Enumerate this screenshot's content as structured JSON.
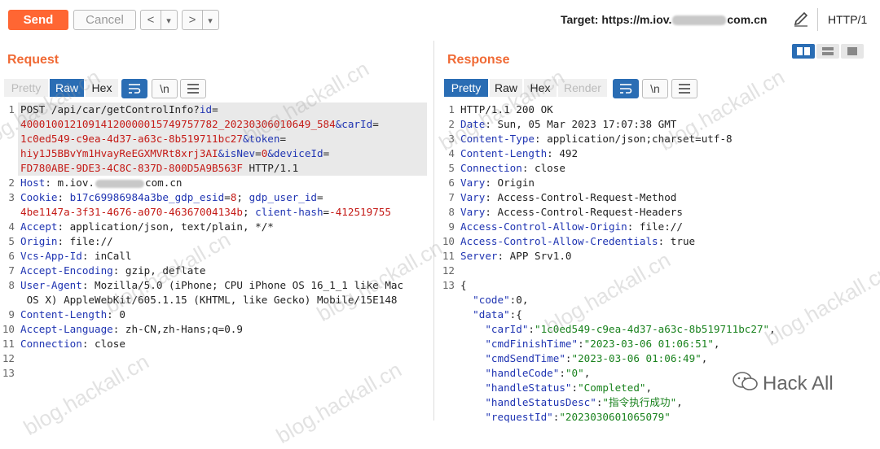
{
  "toolbar": {
    "send_label": "Send",
    "cancel_label": "Cancel",
    "back_glyph": "<",
    "back_dropdown_glyph": "▾",
    "forward_glyph": ">",
    "forward_dropdown_glyph": "▾",
    "target_label": "Target:",
    "target_url_start": "https://m.iov.",
    "target_url_end": "com.cn",
    "protocol": "HTTP/1"
  },
  "request": {
    "title": "Request",
    "tabs": [
      "Pretty",
      "Raw",
      "Hex"
    ],
    "active_tab": "Raw",
    "wrap_icon": "wrap-icon",
    "newline_label": "\\n",
    "menu_icon": "menu-icon",
    "host_blur_start": "m.iov.",
    "host_blur_end": "com.cn"
  },
  "response": {
    "title": "Response",
    "tabs": [
      "Pretty",
      "Raw",
      "Hex",
      "Render"
    ],
    "active_tab": "Pretty",
    "newline_label": "\\n"
  },
  "watermark": "blog.hackall.cn",
  "brand": "Hack All",
  "colors": {
    "send": "#ff6633",
    "title": "#f06a35",
    "tab_active": "#2a6db4",
    "header_key": "#1f34b2",
    "value_red": "#c41a16",
    "json_string": "#19821d"
  }
}
